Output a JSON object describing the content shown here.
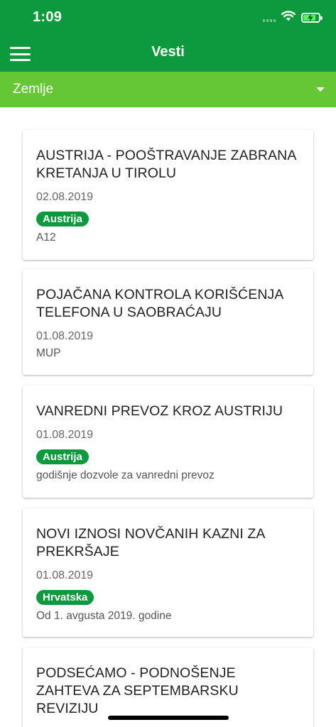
{
  "status_bar": {
    "time": "1:09",
    "icons": [
      "signal-icon",
      "wifi-icon",
      "battery-charging-icon"
    ]
  },
  "nav": {
    "title": "Vesti",
    "menu_icon": "menu-icon"
  },
  "filter": {
    "selected": "Zemlje",
    "icon": "dropdown-caret-icon"
  },
  "news": [
    {
      "title": "AUSTRIJA - POOŠTRAVANJE ZABRANA KRETANJA U TIROLU",
      "date": "02.08.2019",
      "tag": "Austrija",
      "source": "A12"
    },
    {
      "title": "POJAČANA KONTROLA KORIŠĆENJA TELEFONA U SAOBRAĆAJU",
      "date": "01.08.2019",
      "source": "MUP"
    },
    {
      "title": "VANREDNI PREVOZ KROZ AUSTRIJU",
      "date": "01.08.2019",
      "tag": "Austrija",
      "source": "godišnje dozvole za vanredni prevoz"
    },
    {
      "title": "NOVI IZNOSI NOVČANIH KAZNI ZA PREKRŠAJE",
      "date": "01.08.2019",
      "tag": "Hrvatska",
      "source": "Od 1. avgusta 2019. godine"
    },
    {
      "title": "PODSEĆAMO - PODNOŠENJE ZAHTEVA ZA SEPTEMBARSKU REVIZIJU"
    }
  ],
  "colors": {
    "header": "#0c9a3c",
    "filter_bar": "#64c733",
    "badge": "#0c9a3c"
  }
}
